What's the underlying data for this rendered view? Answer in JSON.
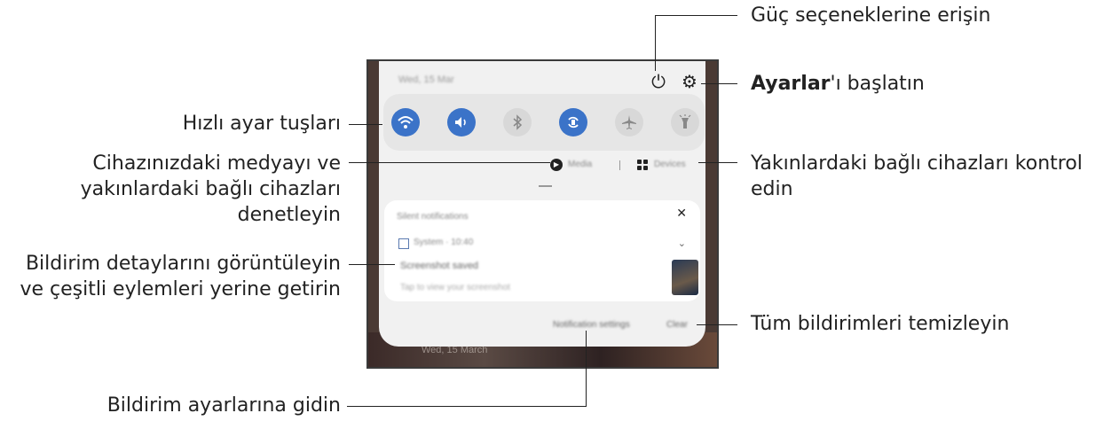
{
  "callouts": {
    "power": "Güç seçeneklerine erişin",
    "settings_bold": "Ayarlar",
    "settings_rest": "'ı başlatın",
    "quick_settings": "Hızlı ayar tuşları",
    "media": [
      "Cihazınızdaki medyayı ve",
      "yakınlardaki bağlı cihazları",
      "denetleyin"
    ],
    "devices": [
      "Yakınlardaki bağlı cihazları kontrol",
      "edin"
    ],
    "notification_details": [
      "Bildirim detaylarını görüntüleyin",
      "ve çeşitli eylemleri yerine getirin"
    ],
    "clear_all": "Tüm bildirimleri temizleyin",
    "notification_settings": "Bildirim ayarlarına gidin"
  },
  "phone": {
    "status_date": "Wed, 15 Mar",
    "quick_tiles": [
      {
        "name": "wifi",
        "state": "on"
      },
      {
        "name": "sound",
        "state": "on"
      },
      {
        "name": "bluetooth",
        "state": "off"
      },
      {
        "name": "auto-rotate",
        "state": "on"
      },
      {
        "name": "airplane-mode",
        "state": "off"
      },
      {
        "name": "flashlight",
        "state": "off"
      }
    ],
    "media_label": "Media",
    "devices_label": "Devices",
    "card_title": "Silent notifications",
    "app_name": "System · 10:40",
    "notification_title": "Screenshot saved",
    "notification_text": "Tap to view your screenshot",
    "notification_settings_button": "Notification settings",
    "clear_button": "Clear",
    "wallpaper_text": "Wed, 15 March"
  },
  "colors": {
    "accent": "#3b73c8",
    "tile_off": "#d8d8d8",
    "panel": "#f1f1f1"
  }
}
